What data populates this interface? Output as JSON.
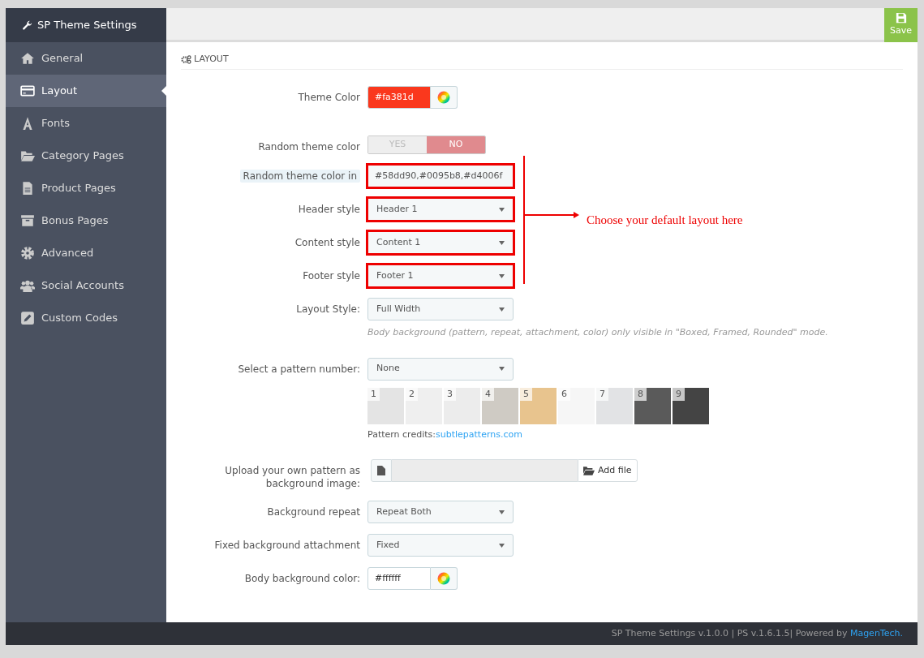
{
  "sidebar": {
    "title": "SP Theme Settings",
    "items": [
      {
        "label": "General",
        "selected": false
      },
      {
        "label": "Layout",
        "selected": true
      },
      {
        "label": "Fonts",
        "selected": false
      },
      {
        "label": "Category Pages",
        "selected": false
      },
      {
        "label": "Product Pages",
        "selected": false
      },
      {
        "label": "Bonus Pages",
        "selected": false
      },
      {
        "label": "Advanced",
        "selected": false
      },
      {
        "label": "Social Accounts",
        "selected": false
      },
      {
        "label": "Custom Codes",
        "selected": false
      }
    ]
  },
  "save_button": "Save",
  "section_title": "LAYOUT",
  "fields": [
    {
      "kind": "color",
      "label": "Theme Color",
      "value": "#fa381d",
      "highlighted": false
    },
    {
      "kind": "toggle",
      "label": "Random theme color",
      "options": [
        {
          "label": "YES",
          "selected": false
        },
        {
          "label": "NO",
          "selected": true
        }
      ],
      "highlighted": false
    },
    {
      "kind": "text",
      "label": "Random theme color in",
      "label_tinted": true,
      "value": "#58dd90,#0095b8,#d4006f",
      "highlighted": true
    },
    {
      "kind": "select",
      "label": "Header style",
      "value": "Header 1",
      "highlighted": true
    },
    {
      "kind": "select",
      "label": "Content style",
      "value": "Content 1",
      "highlighted": true
    },
    {
      "kind": "select",
      "label": "Footer style",
      "value": "Footer 1",
      "highlighted": true
    },
    {
      "kind": "select",
      "label": "Layout Style:",
      "value": "Full Width",
      "highlighted": false,
      "help": "Body background (pattern, repeat, attachment, color) only visible in \"Boxed, Framed, Rounded\" mode."
    },
    {
      "kind": "patterns",
      "label": "Select a pattern number:",
      "value": "None",
      "highlighted": false,
      "patterns": [
        {
          "number": "1",
          "color": "#e4e4e4"
        },
        {
          "number": "2",
          "color": "#efefef"
        },
        {
          "number": "3",
          "color": "#ececec"
        },
        {
          "number": "4",
          "color": "#cfcbc4"
        },
        {
          "number": "5",
          "color": "#e8c48e"
        },
        {
          "number": "6",
          "color": "#f6f6f6"
        },
        {
          "number": "7",
          "color": "#e2e3e5"
        },
        {
          "number": "8",
          "color": "#5a5a5a"
        },
        {
          "number": "9",
          "color": "#444444"
        }
      ],
      "credits_label": "Pattern credits:",
      "credits_link": "subtlepatterns.com"
    },
    {
      "kind": "upload",
      "label": "Upload your own pattern as background image:",
      "button": "Add file",
      "highlighted": false
    },
    {
      "kind": "select",
      "label": "Background repeat",
      "value": "Repeat Both",
      "highlighted": false
    },
    {
      "kind": "select",
      "label": "Fixed background attachment",
      "value": "Fixed",
      "highlighted": false
    },
    {
      "kind": "color",
      "label": "Body background color:",
      "value": "#ffffff",
      "highlighted": false
    }
  ],
  "annotation": "Choose your default layout here",
  "footer": {
    "text": "SP Theme Settings v.1.0.0 | PS v.1.6.1.5| Powered by ",
    "link": "MagenTech."
  }
}
